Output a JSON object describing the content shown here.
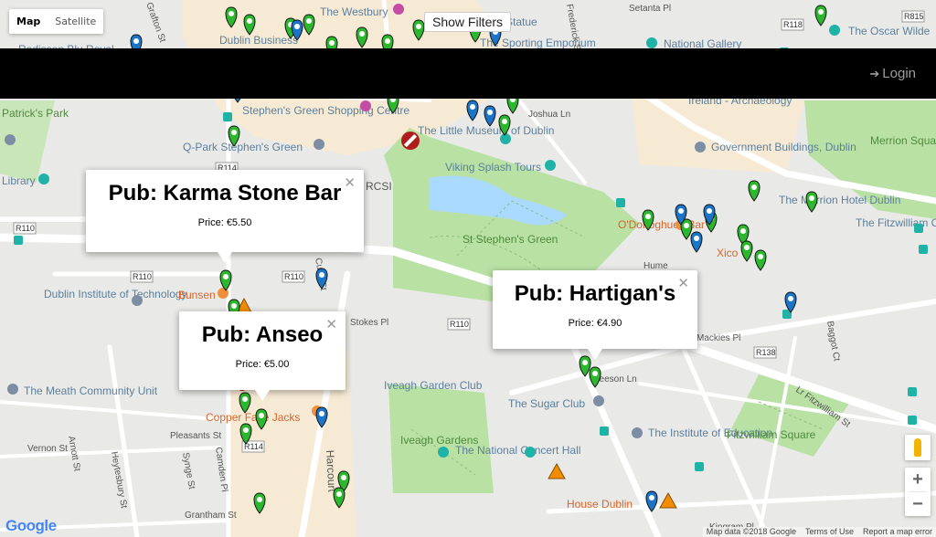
{
  "map_type": {
    "map_label": "Map",
    "satellite_label": "Satellite"
  },
  "filters": {
    "label": "Show Filters"
  },
  "navbar": {
    "login_label": "Login"
  },
  "popups": [
    {
      "title": "Pub: Karma Stone Bar",
      "price": "Price: €5.50"
    },
    {
      "title": "Pub: Anseo",
      "price": "Price: €5.00"
    },
    {
      "title": "Pub: Hartigan's",
      "price": "Price: €4.90"
    }
  ],
  "map_labels": {
    "westbury": "The Westbury",
    "statue": "Statue",
    "sporting": "The Sporting Emporium",
    "gallery": "National Gallery",
    "oscar": "The Oscar Wilde",
    "radisson": "Radisson Blu Royal",
    "dublin_business": "Dublin Business",
    "patricks": "Patrick's Park",
    "stephens_centre": "Stephen's Green Shopping Centre",
    "archaeology": "Ireland - Archaeology",
    "qpark": "Q-Park Stephen's Green",
    "little_museum": "The Little Museum of Dublin",
    "gov_buildings": "Government Buildings, Dublin",
    "merrion_square": "Merrion Square",
    "library": "Library",
    "viking": "Viking Splash Tours",
    "rcsi": "RCSI",
    "merrion_hotel": "The Merrion Hotel Dublin",
    "stephens_green": "St Stephen's Green",
    "odonoghues": "O'Donoghues Bar",
    "fitzwilliam_casino": "The Fitzwilliam Casino and Card Club",
    "xico": "Xico",
    "dit": "Dublin Institute of Technology",
    "bunsen": "Bunsen",
    "stokes": "Stokes Pl",
    "iveagh_club": "Iveagh Garden Club",
    "meath": "The Meath Community Unit",
    "sugar_club": "The Sugar Club",
    "copper_jacks": "Copper Face Jacks",
    "pleasants": "Pleasants St",
    "iveagh_gardens": "Iveagh Gardens",
    "concert_hall": "The National Concert Hall",
    "institute_education": "The Institute of Education",
    "fitzwilliam_square": "Fitzwilliam Square",
    "house_dublin": "House Dublin",
    "heytesbury": "Heytesbury St",
    "harcourt": "Harcourt",
    "leeson": "Leeson Ln",
    "mackies": "Mackies Pl",
    "baggot": "Baggot Ct",
    "lr_fitzwilliam": "Lr Fitzwilliam St",
    "kingram": "Kingram Pl",
    "grantham": "Grantham St",
    "vernon": "Vernon St",
    "arnott": "Arnott St",
    "synge": "Synge St",
    "camden": "Camden Pl",
    "joshua": "Joshua Ln",
    "hume": "Hume",
    "cuffe": "Cuffe St",
    "r110": "R110",
    "r114": "R114",
    "r118": "R118",
    "r138": "R138",
    "r815": "R815",
    "grafton": "Grafton St",
    "setanta": "Setanta Pl",
    "frederick": "Frederick St"
  },
  "controls": {
    "zoom_in": "+",
    "zoom_out": "−"
  },
  "footer": {
    "google": "Google",
    "map_data": "Map data ©2018 Google",
    "terms": "Terms of Use",
    "report": "Report a map error"
  },
  "colors": {
    "park": "#b5e0a2",
    "water": "#aadaff",
    "pin_green": "#2cb82c",
    "pin_blue": "#1a75c8",
    "warning": "#f28c00",
    "navbar": "#000000"
  }
}
